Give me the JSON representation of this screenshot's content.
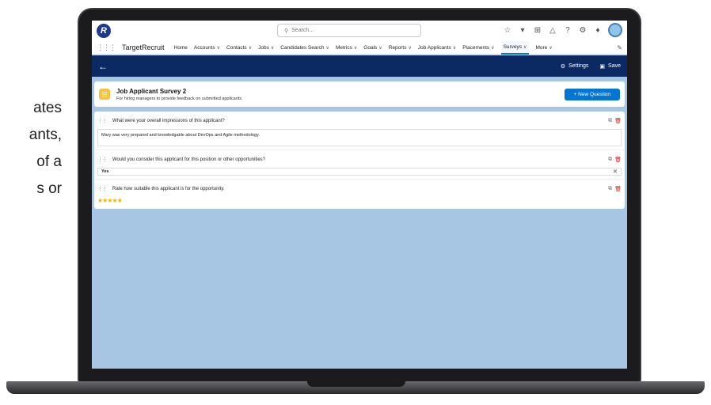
{
  "side_text": [
    "ates",
    "ants,",
    "of  a",
    "s  or"
  ],
  "header": {
    "logo_glyph": "R",
    "search_placeholder": "Search...",
    "app_name": "TargetRecruit",
    "nav": [
      {
        "label": "Home",
        "chevron": false
      },
      {
        "label": "Accounts",
        "chevron": true
      },
      {
        "label": "Contacts",
        "chevron": true
      },
      {
        "label": "Jobs",
        "chevron": true
      },
      {
        "label": "Candidates Search",
        "chevron": true
      },
      {
        "label": "Metrics",
        "chevron": true
      },
      {
        "label": "Goals",
        "chevron": true
      },
      {
        "label": "Reports",
        "chevron": true
      },
      {
        "label": "Job Applicants",
        "chevron": true
      },
      {
        "label": "Placements",
        "chevron": true
      },
      {
        "label": "Surveys",
        "chevron": true,
        "active": true
      },
      {
        "label": "More",
        "chevron": true
      }
    ]
  },
  "toolbar": {
    "settings_label": "Settings",
    "save_label": "Save"
  },
  "survey": {
    "title": "Job Applicant Survey 2",
    "subtitle": "For hiring managers to provide feedback on submitted applicants.",
    "new_question_label": "+ New Question"
  },
  "questions": [
    {
      "text": "What were your overall impressions of this applicant?",
      "type": "textarea",
      "answer": "Mary was very prepared and knowledgable about DevOps and Agile methodology."
    },
    {
      "text": "Would you consider this applicant for this position or other opportunities?",
      "type": "select",
      "answer": "Yes"
    },
    {
      "text": "Rate how suitable this applicant is for the opportunity.",
      "type": "rating",
      "rating": 5,
      "max": 5
    }
  ],
  "colors": {
    "brand_navy": "#0b2a63",
    "accent_blue": "#0176d3",
    "page_bg": "#a7c6e4",
    "star": "#f4b400",
    "delete_red": "#d21f1f"
  }
}
